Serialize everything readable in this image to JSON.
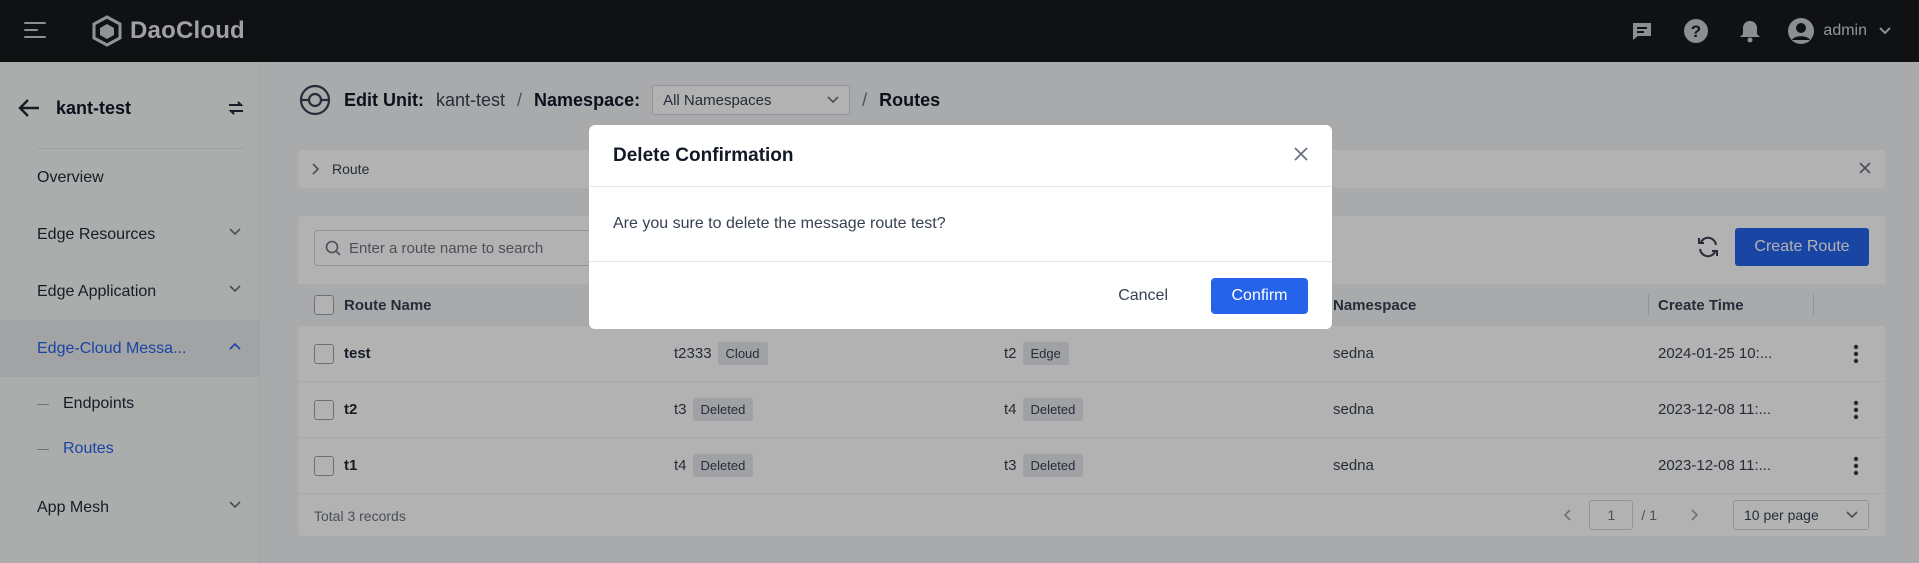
{
  "app": {
    "brand": "DaoCloud",
    "user_name": "admin",
    "accent": "#2563eb"
  },
  "sidebar": {
    "title": "kant-test",
    "items": [
      {
        "label": "Overview"
      },
      {
        "label": "Edge Resources"
      },
      {
        "label": "Edge Application"
      },
      {
        "label": "Edge-Cloud Messa..."
      },
      {
        "label": "App Mesh"
      }
    ],
    "sub_items": [
      {
        "label": "Endpoints"
      },
      {
        "label": "Routes"
      }
    ]
  },
  "breadcrumb": {
    "edit_unit_label": "Edit Unit:",
    "unit_name": "kant-test",
    "sep": "/",
    "namespace_label": "Namespace:",
    "namespace_value": "All Namespaces",
    "page": "Routes"
  },
  "info_bar": {
    "label": "Route"
  },
  "toolbar": {
    "search_placeholder": "Enter a route name to search",
    "create_label": "Create Route"
  },
  "table": {
    "columns": [
      "Route Name",
      "Namespace",
      "Create Time"
    ],
    "rows": [
      {
        "name": "test",
        "source": "t2333",
        "source_tag": "Cloud",
        "target": "t2",
        "target_tag": "Edge",
        "namespace": "sedna",
        "time": "2024-01-25 10:..."
      },
      {
        "name": "t2",
        "source": "t3",
        "source_tag": "Deleted",
        "target": "t4",
        "target_tag": "Deleted",
        "namespace": "sedna",
        "time": "2023-12-08 11:..."
      },
      {
        "name": "t1",
        "source": "t4",
        "source_tag": "Deleted",
        "target": "t3",
        "target_tag": "Deleted",
        "namespace": "sedna",
        "time": "2023-12-08 11:..."
      }
    ],
    "total": "Total 3 records",
    "page_current": "1",
    "page_total": "/ 1",
    "per_page": "10 per page"
  },
  "modal": {
    "title": "Delete Confirmation",
    "message": "Are you sure to delete the message route test?",
    "cancel_label": "Cancel",
    "confirm_label": "Confirm"
  }
}
